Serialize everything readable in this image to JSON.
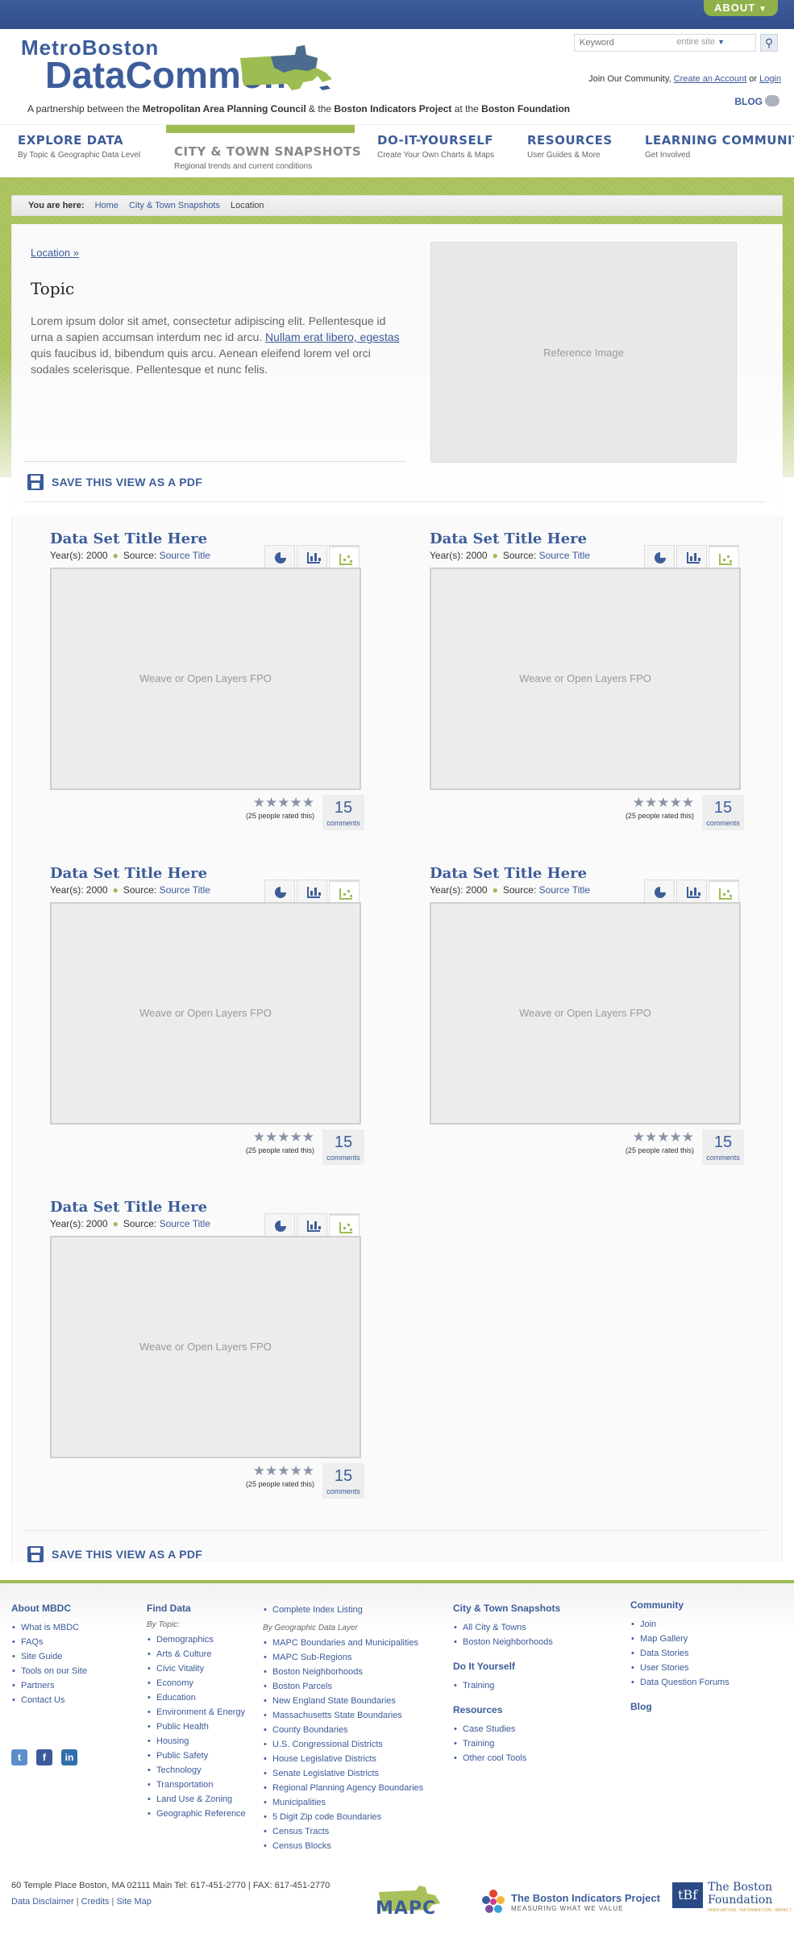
{
  "header": {
    "about_label": "ABOUT",
    "logo_top": "MetroBoston",
    "logo_main": "DataCommon",
    "partner_prefix": "A partnership between the",
    "partner_org1": "Metropolitan Area Planning Council",
    "partner_and": "& the",
    "partner_org2": "Boston Indicators Project",
    "partner_at": "at the",
    "partner_org3": "Boston Foundation",
    "search_placeholder": "Keyword",
    "search_scope": "entire site",
    "community_text": "Join Our Community,",
    "create_account": "Create an Account",
    "or": "or",
    "login": "Login",
    "blog": "BLOG"
  },
  "nav": [
    {
      "title": "EXPLORE DATA",
      "subtitle": "By Topic & Geographic Data Level"
    },
    {
      "title": "CITY & TOWN SNAPSHOTS",
      "subtitle": "Regional trends and current conditions"
    },
    {
      "title": "DO-IT-YOURSELF",
      "subtitle": "Create Your Own Charts & Maps"
    },
    {
      "title": "RESOURCES",
      "subtitle": "User Guides & More"
    },
    {
      "title": "LEARNING COMMUNITY",
      "subtitle": "Get Involved"
    }
  ],
  "breadcrumb": {
    "you_are_here": "You are here:",
    "home": "Home",
    "snapshots": "City & Town Snapshots",
    "current": "Location"
  },
  "intro": {
    "location_link": "Location »",
    "topic": "Topic",
    "lorem_before": "Lorem ipsum dolor sit amet, consectetur adipiscing elit. Pellentesque id urna a sapien accumsan interdum nec id arcu. ",
    "lorem_link": "Nullam erat libero, egestas",
    "lorem_after": " quis faucibus id, bibendum quis arcu. Aenean eleifend lorem vel orci sodales scelerisque. Pellentesque et nunc felis.",
    "reference_image": "Reference Image"
  },
  "save_pdf": "SAVE THIS VIEW AS A PDF",
  "datasets": [
    {
      "title": "Data Set Title Here",
      "years_label": "Year(s): 2000",
      "source_label": "Source:",
      "source_link": "Source Title",
      "viz_placeholder": "Weave or Open Layers FPO",
      "stars": "★★★★★",
      "rated": "(25 people rated this)",
      "comments_count": "15",
      "comments_label": "comments"
    },
    {
      "title": "Data Set Title Here",
      "years_label": "Year(s): 2000",
      "source_label": "Source:",
      "source_link": "Source Title",
      "viz_placeholder": "Weave or Open Layers FPO",
      "stars": "★★★★★",
      "rated": "(25 people rated this)",
      "comments_count": "15",
      "comments_label": "comments"
    },
    {
      "title": "Data Set Title Here",
      "years_label": "Year(s): 2000",
      "source_label": "Source:",
      "source_link": "Source Title",
      "viz_placeholder": "Weave or Open Layers FPO",
      "stars": "★★★★★",
      "rated": "(25 people rated this)",
      "comments_count": "15",
      "comments_label": "comments"
    },
    {
      "title": "Data Set Title Here",
      "years_label": "Year(s): 2000",
      "source_label": "Source:",
      "source_link": "Source Title",
      "viz_placeholder": "Weave or Open Layers FPO",
      "stars": "★★★★★",
      "rated": "(25 people rated this)",
      "comments_count": "15",
      "comments_label": "comments"
    },
    {
      "title": "Data Set Title Here",
      "years_label": "Year(s): 2000",
      "source_label": "Source:",
      "source_link": "Source Title",
      "viz_placeholder": "Weave or Open Layers FPO",
      "stars": "★★★★★",
      "rated": "(25 people rated this)",
      "comments_count": "15",
      "comments_label": "comments"
    }
  ],
  "footer": {
    "about": {
      "title": "About MBDC",
      "items": [
        "What is MBDC",
        "FAQs",
        "Site Guide",
        "Tools on our Site",
        "Partners",
        "Contact Us"
      ]
    },
    "find_data": {
      "title": "Find Data",
      "by_topic": "By Topic:",
      "items": [
        "Demographics",
        "Arts & Culture",
        "Civic Vitality",
        "Economy",
        "Education",
        "Environment & Energy",
        "Public Health",
        "Housing",
        "Public Safety",
        "Technology",
        "Transportation",
        "Land Use & Zoning",
        "Geographic Reference"
      ]
    },
    "geo": {
      "index": "Complete Index Listing",
      "by_geo": "By Geographic Data Layer",
      "items": [
        "MAPC Boundaries and Municipalities",
        "MAPC Sub-Regions",
        "Boston Neighborhoods",
        "Boston Parcels",
        "New England State Boundaries",
        "Massachusetts State Boundaries",
        "County Boundaries",
        "U.S. Congressional Districts",
        "House Legislative Districts",
        "Senate Legislative Districts",
        "Regional Planning Agency Boundaries",
        "Municipalities",
        "5 Digit Zip code Boundaries",
        "Census Tracts",
        "Census Blocks"
      ]
    },
    "snapshots": {
      "title": "City & Town Snapshots",
      "items": [
        "All City & Towns",
        "Boston Neighborhoods"
      ]
    },
    "diy": {
      "title": "Do It Yourself",
      "items": [
        "Training"
      ]
    },
    "resources": {
      "title": "Resources",
      "items": [
        "Case Studies",
        "Training",
        "Other cool Tools"
      ]
    },
    "community": {
      "title": "Community",
      "items": [
        "Join",
        "Map Gallery",
        "Data Stories",
        "User Stories",
        "Data Question Forums"
      ]
    },
    "blog": "Blog",
    "social": [
      "t",
      "f",
      "in"
    ],
    "address": "60 Temple Place Boston, MA 02111   Main Tel: 617-451-2770  |  FAX: 617-451-2770",
    "disclaimer": "Data Disclaimer",
    "credits": "Credits",
    "sitemap": "Site Map",
    "mapc": "MAPC",
    "bip_title": "The Boston Indicators Project",
    "bip_tag": "MEASURING WHAT WE VALUE",
    "tbf_mark": "tBf",
    "tbf_name1": "The Boston",
    "tbf_name2": "Foundation",
    "tbf_tag": "INNOVATION. INFORMATION. IMPACT."
  },
  "colors": {
    "brand_blue": "#3d5d9a",
    "brand_green": "#9dbd52"
  }
}
